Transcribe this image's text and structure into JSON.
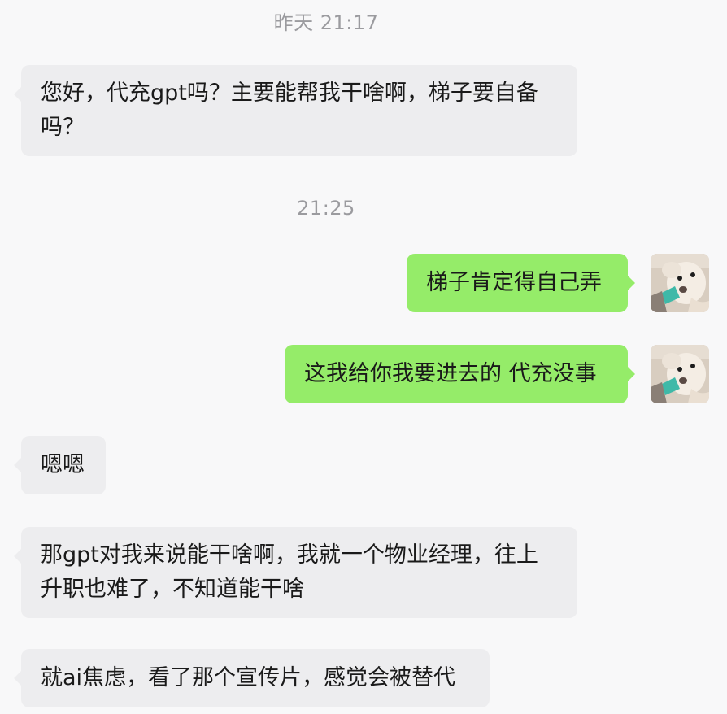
{
  "messages": [
    {
      "type": "time",
      "text": "昨天 21:17"
    },
    {
      "type": "received",
      "text": "您好，代充gpt吗？主要能帮我干啥啊，梯子要自备吗？"
    },
    {
      "type": "time",
      "text": "21:25"
    },
    {
      "type": "sent",
      "text": "梯子肯定得自己弄"
    },
    {
      "type": "sent",
      "text": "这我给你我要进去的 代充没事"
    },
    {
      "type": "received",
      "text": "嗯嗯"
    },
    {
      "type": "received",
      "text": "那gpt对我来说能干啥啊，我就一个物业经理，往上升职也难了，不知道能干啥"
    },
    {
      "type": "received",
      "text": "就ai焦虑，看了那个宣传片，感觉会被替代"
    }
  ],
  "avatar": {
    "icon": "dog-avatar-icon"
  },
  "colors": {
    "background": "#f8f8f9",
    "received_bubble": "#ededef",
    "sent_bubble": "#95ec69",
    "timestamp_text": "#9b9b9f"
  }
}
